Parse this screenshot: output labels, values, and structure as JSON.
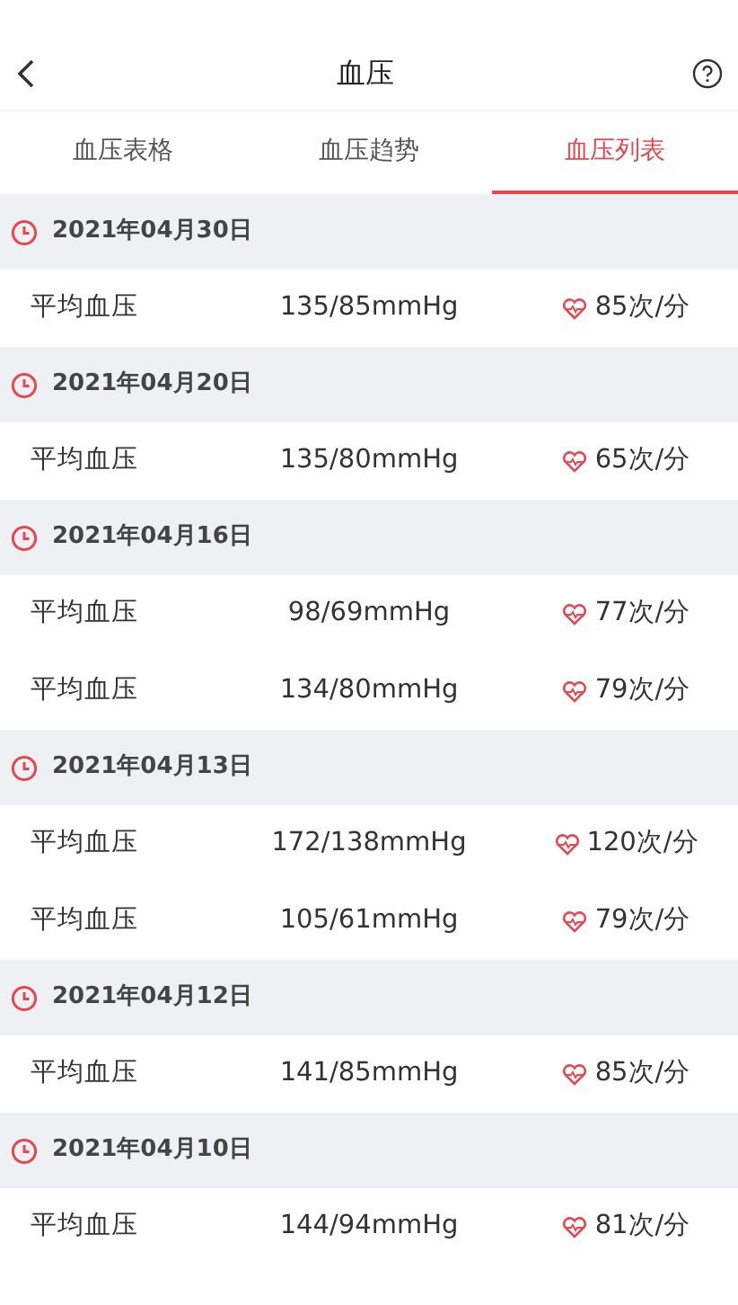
{
  "header": {
    "title": "血压"
  },
  "tabs": [
    {
      "label": "血压表格",
      "selected": false
    },
    {
      "label": "血压趋势",
      "selected": false
    },
    {
      "label": "血压列表",
      "selected": true
    }
  ],
  "groups": [
    {
      "date": "2021年04月30日",
      "records": [
        {
          "label": "平均血压",
          "pressure": "135/85mmHg",
          "pulse": "85次/分"
        }
      ]
    },
    {
      "date": "2021年04月20日",
      "records": [
        {
          "label": "平均血压",
          "pressure": "135/80mmHg",
          "pulse": "65次/分"
        }
      ]
    },
    {
      "date": "2021年04月16日",
      "records": [
        {
          "label": "平均血压",
          "pressure": "98/69mmHg",
          "pulse": "77次/分"
        },
        {
          "label": "平均血压",
          "pressure": "134/80mmHg",
          "pulse": "79次/分"
        }
      ]
    },
    {
      "date": "2021年04月13日",
      "records": [
        {
          "label": "平均血压",
          "pressure": "172/138mmHg",
          "pulse": "120次/分"
        },
        {
          "label": "平均血压",
          "pressure": "105/61mmHg",
          "pulse": "79次/分"
        }
      ]
    },
    {
      "date": "2021年04月12日",
      "records": [
        {
          "label": "平均血压",
          "pressure": "141/85mmHg",
          "pulse": "85次/分"
        }
      ]
    },
    {
      "date": "2021年04月10日",
      "records": [
        {
          "label": "平均血压",
          "pressure": "144/94mmHg",
          "pulse": "81次/分"
        }
      ]
    }
  ]
}
